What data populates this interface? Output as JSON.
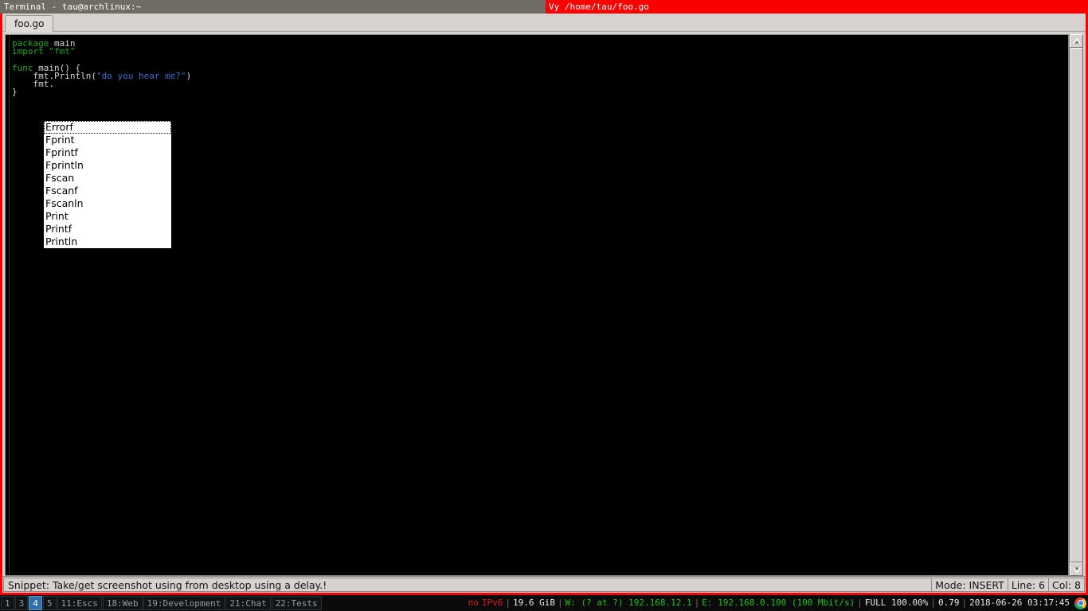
{
  "window": {
    "terminal_title": "Terminal - tau@archlinux:~",
    "editor_title": "Vy /home/tau/foo.go",
    "title_accent": "#fc0000",
    "titlebar_bg": "#6e6c63"
  },
  "tabs": [
    {
      "label": "foo.go",
      "active": true
    }
  ],
  "editor": {
    "lines": [
      [
        {
          "t": "package",
          "c": "kw"
        },
        {
          "t": " ",
          "c": "punc"
        },
        {
          "t": "main",
          "c": "ident"
        }
      ],
      [
        {
          "t": "import",
          "c": "kw"
        },
        {
          "t": " ",
          "c": "punc"
        },
        {
          "t": "\"fmt\"",
          "c": "strg"
        }
      ],
      [
        {
          "t": "",
          "c": "punc"
        }
      ],
      [
        {
          "t": "func",
          "c": "kw"
        },
        {
          "t": " ",
          "c": "punc"
        },
        {
          "t": "main() {",
          "c": "ident"
        }
      ],
      [
        {
          "t": "    fmt.Println(",
          "c": "fn"
        },
        {
          "t": "\"do you hear me?\"",
          "c": "str"
        },
        {
          "t": ")",
          "c": "fn"
        }
      ],
      [
        {
          "t": "    fmt.",
          "c": "fn"
        }
      ],
      [
        {
          "t": "}",
          "c": "punc"
        }
      ]
    ]
  },
  "autocomplete": {
    "items": [
      {
        "label": "Errorf",
        "selected": true
      },
      {
        "label": "Fprint",
        "selected": false
      },
      {
        "label": "Fprintf",
        "selected": false
      },
      {
        "label": "Fprintln",
        "selected": false
      },
      {
        "label": "Fscan",
        "selected": false
      },
      {
        "label": "Fscanf",
        "selected": false
      },
      {
        "label": "Fscanln",
        "selected": false
      },
      {
        "label": "Print",
        "selected": false
      },
      {
        "label": "Printf",
        "selected": false
      },
      {
        "label": "Println",
        "selected": false
      }
    ]
  },
  "scrollbar": {
    "up_icon": "triangle-up-icon",
    "down_icon": "triangle-down-icon"
  },
  "statusbar": {
    "message": "Snippet: Take/get screenshot using from desktop using a delay.!",
    "mode": "Mode: INSERT",
    "line": "Line: 6",
    "col": "Col: 8"
  },
  "taskbar": {
    "workspaces": [
      {
        "label": "1",
        "active": false
      },
      {
        "label": "3",
        "active": false
      },
      {
        "label": "4",
        "active": true
      },
      {
        "label": "5",
        "active": false
      },
      {
        "label": "11:Escs",
        "active": false
      },
      {
        "label": "18:Web",
        "active": false
      },
      {
        "label": "19:Development",
        "active": false
      },
      {
        "label": "21:Chat",
        "active": false
      },
      {
        "label": "22:Tests",
        "active": false
      }
    ],
    "tray": {
      "ipv6_status": "no",
      "ipv6_label": "IPv6",
      "disk": "19.6 GiB",
      "wifi": "W: (? at ?) 192.168.12.1",
      "ethernet": "E: 192.168.0.100 (100 Mbit/s)",
      "battery": "FULL 100.00%",
      "load": "0.79",
      "clock": "2018-06-26 03:17:45",
      "app_icon": "chrome-icon"
    },
    "colors": {
      "red": "#e01b1b",
      "green": "#20c020",
      "white": "#e8e8e8",
      "active_ws": "#2f6fa8"
    }
  }
}
